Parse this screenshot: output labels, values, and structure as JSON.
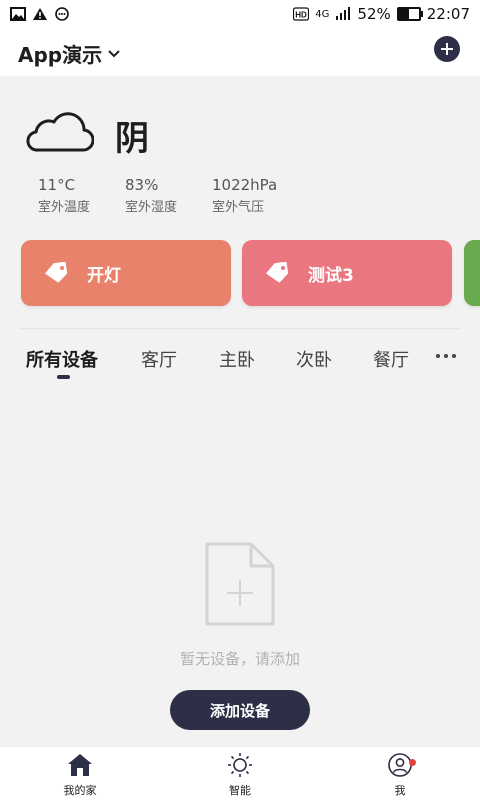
{
  "status_bar": {
    "left_icons": [
      "image-icon",
      "warning-icon",
      "chat-icon"
    ],
    "network": "4G",
    "battery_percent_text": "52%",
    "battery_level": 0.52,
    "time": "22:07"
  },
  "header": {
    "title": "App演示",
    "add_icon": "plus-circle-icon"
  },
  "weather": {
    "condition": "阴",
    "icon": "cloud-icon",
    "stats": [
      {
        "value": "11°C",
        "label": "室外温度"
      },
      {
        "value": "83%",
        "label": "室外湿度"
      },
      {
        "value": "1022hPa",
        "label": "室外气压"
      }
    ]
  },
  "scenes": [
    {
      "label": "开灯",
      "color": "#e8826a"
    },
    {
      "label": "测试3",
      "color": "#ea7680"
    },
    {
      "label": "",
      "color": "#6aaa4e"
    }
  ],
  "tabs": {
    "items": [
      "所有设备",
      "客厅",
      "主卧",
      "次卧",
      "餐厅"
    ],
    "active_index": 0,
    "more_icon": "more-dots-icon"
  },
  "empty_state": {
    "icon": "add-file-icon",
    "text": "暂无设备，请添加",
    "button_label": "添加设备"
  },
  "bottom_nav": {
    "items": [
      {
        "label": "我的家",
        "icon": "home-icon"
      },
      {
        "label": "智能",
        "icon": "sun-icon"
      },
      {
        "label": "我",
        "icon": "user-icon"
      }
    ],
    "accent": "#2c2f46",
    "badge_color": "#e0423a"
  }
}
